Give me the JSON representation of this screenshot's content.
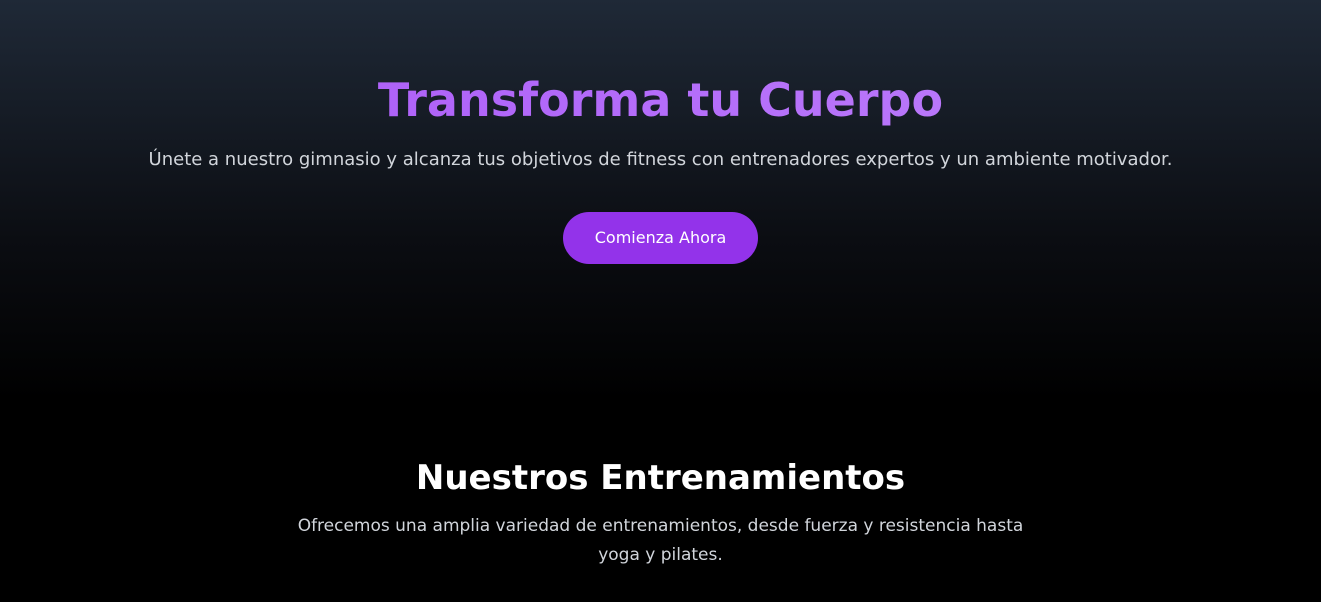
{
  "hero": {
    "title": "Transforma tu Cuerpo",
    "subtitle": "Únete a nuestro gimnasio y alcanza tus objetivos de fitness con entrenadores expertos y un ambiente motivador.",
    "cta_label": "Comienza Ahora"
  },
  "trainings": {
    "title": "Nuestros Entrenamientos",
    "description": "Ofrecemos una amplia variedad de entrenamientos, desde fuerza y resistencia hasta yoga y pilates."
  },
  "colors": {
    "accent": "#9333ea",
    "title_gradient_start": "#a855f7",
    "title_gradient_end": "#c084fc",
    "hero_top": "#1f2937",
    "background": "#000000",
    "body_text": "#d1d5db"
  }
}
